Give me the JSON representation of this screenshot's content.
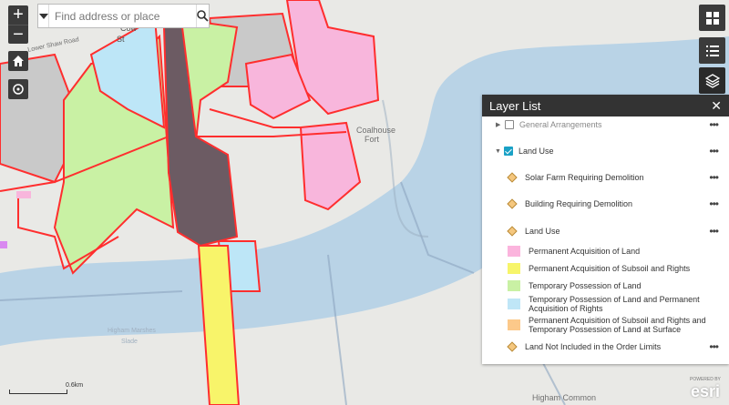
{
  "map": {
    "labels": {
      "coalhouse": "Coalhouse",
      "fort": "Fort",
      "higham": "Higham Common",
      "cow": "Cow",
      "st": "St",
      "road": "Lower Shaw Road",
      "marsh": "Higham Marshes",
      "slade": "Slade"
    },
    "colors": {
      "water": "#b9d3e6",
      "land": "#e8e8e5",
      "pink": "#f8b6dc",
      "green": "#c9f1a4",
      "lightblue": "#bde6f7",
      "red": "#ff2e2e",
      "grey": "#c9c9c9",
      "yellow": "#f8f46a"
    }
  },
  "zoom": {
    "in": "+",
    "out": "−"
  },
  "search": {
    "placeholder": "Find address or place"
  },
  "panel": {
    "title": "Layer List",
    "close": "✕",
    "groups": [
      {
        "label": "General Arrangements",
        "checked": false
      },
      {
        "label": "Land Use",
        "checked": true
      }
    ],
    "sublayers": [
      "Solar Farm Requiring Demolition",
      "Building Requiring Demolition",
      "Land Use"
    ],
    "legend": [
      {
        "label": "Permanent Acquisition of Land",
        "color": "#fbb4dd"
      },
      {
        "label": "Permanent Acquisition of Subsoil and Rights",
        "color": "#f7f56a"
      },
      {
        "label": "Temporary Possession of Land",
        "color": "#c9f1a4"
      },
      {
        "label": "Temporary Possession of Land and Permanent Acquisition of Rights",
        "color": "#bfe6f7"
      },
      {
        "label": "Permanent Acquisition of Subsoil and Rights and Temporary Possession of Land at Surface",
        "color": "#fcc98a"
      }
    ],
    "last_layer": "Land Not Included in the Order Limits",
    "more": "•••"
  },
  "scale": {
    "label": "0.6km"
  },
  "brand": {
    "logo": "esri",
    "attribution": "POWERED BY"
  }
}
